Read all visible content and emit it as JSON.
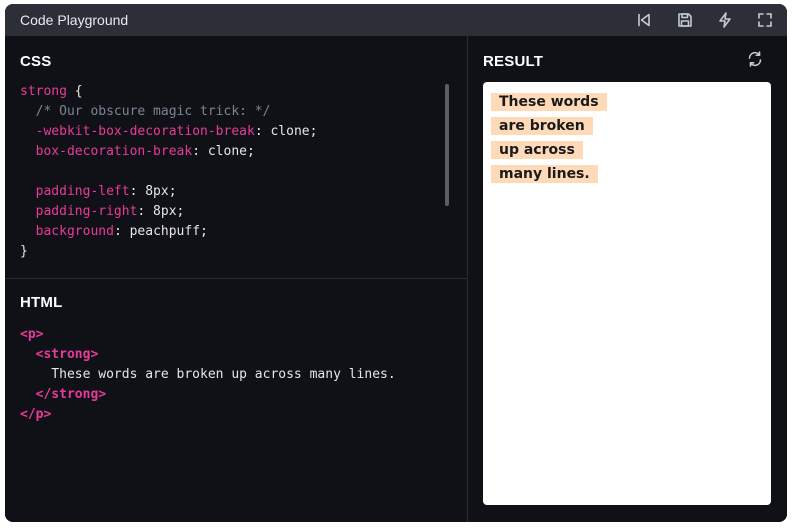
{
  "window": {
    "title": "Code Playground"
  },
  "toolbar": {
    "icons": [
      "reset-icon",
      "save-icon",
      "format-icon",
      "fullscreen-icon"
    ],
    "icon_color": "#c5c9d2"
  },
  "css_panel": {
    "heading": "CSS",
    "lines": [
      [
        {
          "t": "strong",
          "c": "kw"
        },
        {
          "t": " {",
          "c": ""
        }
      ],
      [
        {
          "t": "  /* Our obscure magic trick: */",
          "c": "cm"
        }
      ],
      [
        {
          "t": "  ",
          "c": ""
        },
        {
          "t": "-webkit-box-decoration-break",
          "c": "kw"
        },
        {
          "t": ": clone;",
          "c": ""
        }
      ],
      [
        {
          "t": "  ",
          "c": ""
        },
        {
          "t": "box-decoration-break",
          "c": "kw"
        },
        {
          "t": ": clone;",
          "c": ""
        }
      ],
      [],
      [
        {
          "t": "  ",
          "c": ""
        },
        {
          "t": "padding-left",
          "c": "kw"
        },
        {
          "t": ": 8px;",
          "c": ""
        }
      ],
      [
        {
          "t": "  ",
          "c": ""
        },
        {
          "t": "padding-right",
          "c": "kw"
        },
        {
          "t": ": 8px;",
          "c": ""
        }
      ],
      [
        {
          "t": "  ",
          "c": ""
        },
        {
          "t": "background",
          "c": "kw"
        },
        {
          "t": ": peachpuff;",
          "c": ""
        }
      ],
      [
        {
          "t": "}",
          "c": ""
        }
      ]
    ]
  },
  "html_panel": {
    "heading": "HTML",
    "lines": [
      [
        {
          "t": "<p>",
          "c": "tag"
        }
      ],
      [
        {
          "t": "  ",
          "c": ""
        },
        {
          "t": "<strong>",
          "c": "tag"
        }
      ],
      [
        {
          "t": "    These words are broken up across many lines.",
          "c": ""
        }
      ],
      [
        {
          "t": "  ",
          "c": ""
        },
        {
          "t": "</strong>",
          "c": "tag"
        }
      ],
      [
        {
          "t": "</p>",
          "c": "tag"
        }
      ]
    ]
  },
  "result_panel": {
    "heading": "RESULT",
    "text": "These words are broken up across many lines.",
    "highlight_color": "peachpuff"
  },
  "colors": {
    "accent_pink": "#e93a9a",
    "comment": "#7b8494",
    "panel_bg": "#101116",
    "titlebar_bg": "#2c2f38"
  }
}
